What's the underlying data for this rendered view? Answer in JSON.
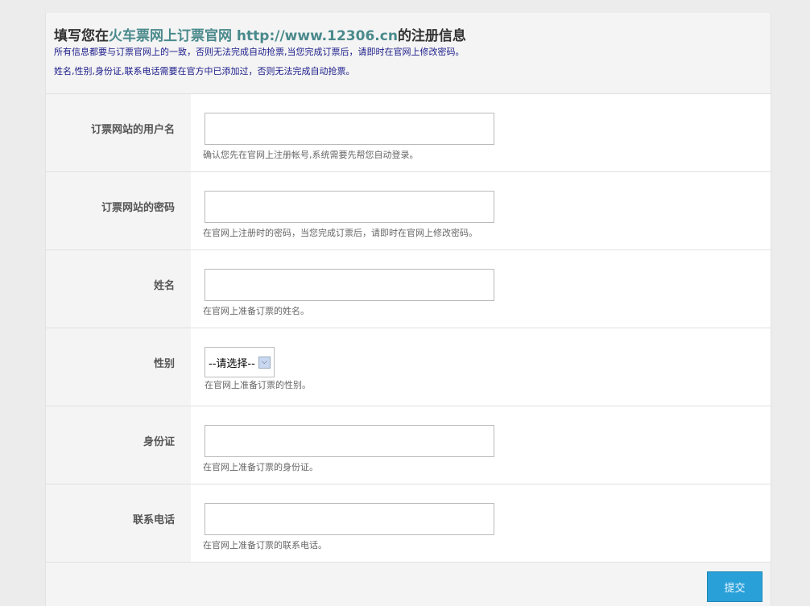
{
  "header": {
    "title_pre": "填写您在",
    "title_link": "火车票网上订票官网 http://www.12306.cn",
    "title_post": "的注册信息",
    "note1": "所有信息都要与订票官网上的一致，否则无法完成自动抢票,当您完成订票后，请即时在官网上修改密码。",
    "note2": "姓名,性别,身份证,联系电话需要在官方中已添加过，否则无法完成自动抢票。"
  },
  "fields": [
    {
      "label": "订票网站的用户名",
      "value": "",
      "hint": "确认您先在官网上注册帐号,系统需要先帮您自动登录。"
    },
    {
      "label": "订票网站的密码",
      "value": "",
      "hint": "在官网上注册时的密码，当您完成订票后，请即时在官网上修改密码。"
    },
    {
      "label": "姓名",
      "value": "",
      "hint": "在官网上准备订票的姓名。"
    },
    {
      "label": "性别",
      "selected": "--请选择--",
      "hint": "在官网上准备订票的性别。"
    },
    {
      "label": "身份证",
      "value": "",
      "hint": "在官网上准备订票的身份证。"
    },
    {
      "label": "联系电话",
      "value": "",
      "hint": "在官网上准备订票的联系电话。"
    }
  ],
  "submit_label": "提交",
  "colors": {
    "accent": "#2aa0d8",
    "link": "#4a8a8c",
    "note": "#1a1a8a"
  }
}
